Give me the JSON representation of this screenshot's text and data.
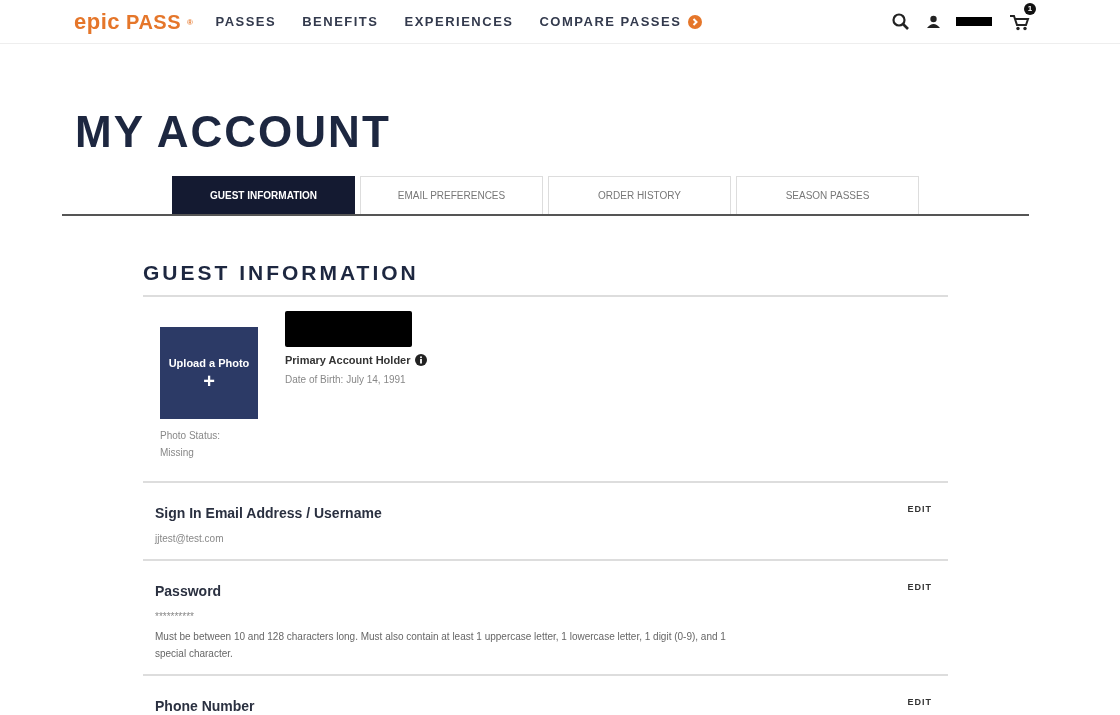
{
  "header": {
    "logo": {
      "word1": "epic",
      "word2": "PASS",
      "mark": "®"
    },
    "nav": [
      {
        "label": "PASSES"
      },
      {
        "label": "BENEFITS"
      },
      {
        "label": "EXPERIENCES"
      },
      {
        "label": "COMPARE PASSES",
        "arrow": true
      }
    ],
    "cart_count": "1"
  },
  "page_title": "MY ACCOUNT",
  "tabs": [
    {
      "label": "GUEST INFORMATION",
      "selected": true
    },
    {
      "label": "EMAIL PREFERENCES",
      "selected": false
    },
    {
      "label": "ORDER HISTORY",
      "selected": false
    },
    {
      "label": "SEASON PASSES",
      "selected": false
    }
  ],
  "section_title": "GUEST INFORMATION",
  "profile": {
    "upload_label": "Upload a Photo",
    "plus": "+",
    "photo_status": "Photo Status:",
    "photo_status_value": "Missing",
    "role": "Primary Account Holder",
    "birth": "Date of Birth: July 14, 1991"
  },
  "fields": [
    {
      "label": "Sign In Email Address / Username",
      "value": "jjtest@test.com",
      "action": "EDIT"
    },
    {
      "label": "Password",
      "value": "**********",
      "note": "Must be between 10 and 128 characters long. Must also contain at least 1 uppercase letter, 1 lowercase letter, 1 digit (0-9), and 1 special character.",
      "action": "EDIT"
    },
    {
      "label": "Phone Number",
      "action": "EDIT"
    }
  ]
}
